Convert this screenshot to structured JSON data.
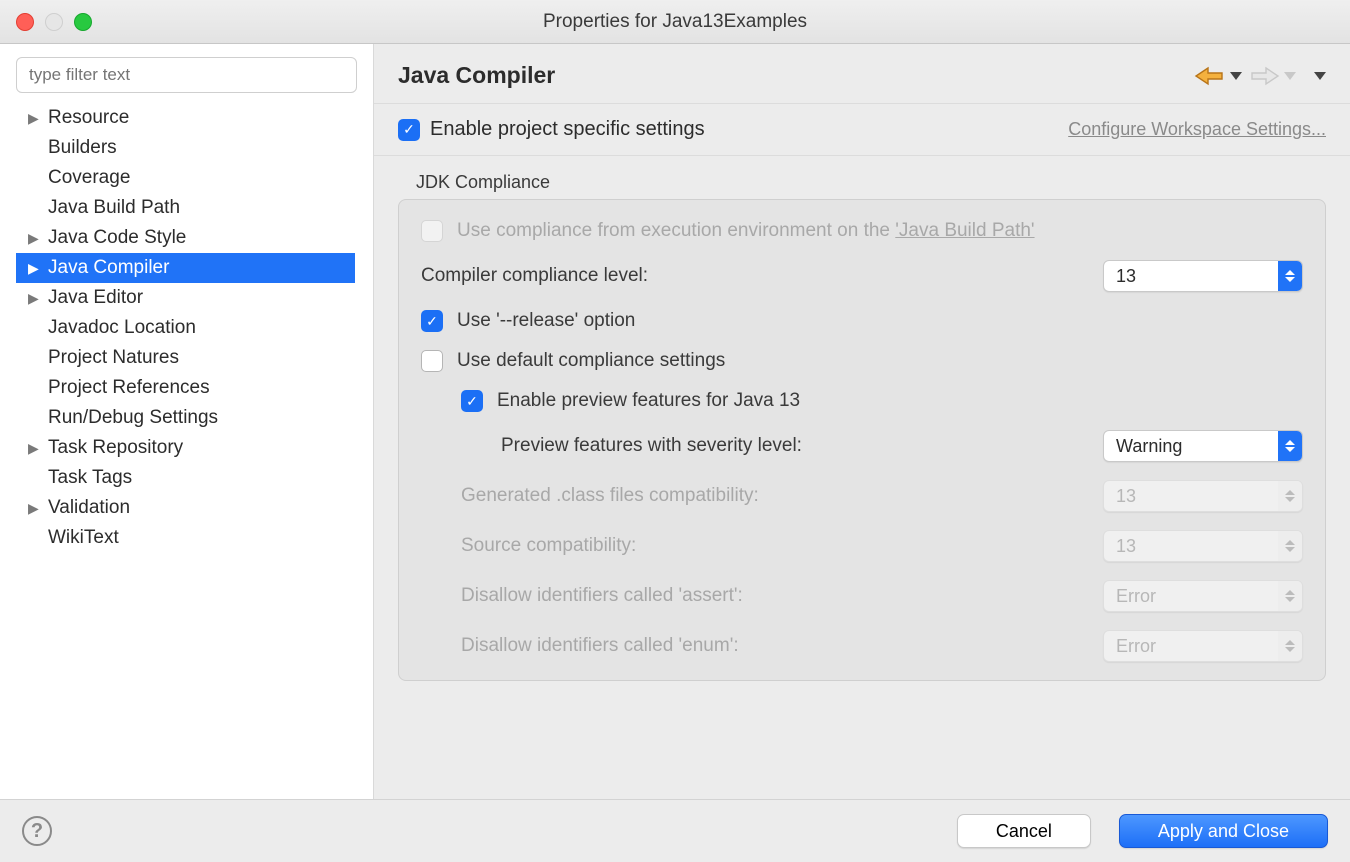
{
  "window": {
    "title": "Properties for Java13Examples"
  },
  "sidebar": {
    "filter_placeholder": "type filter text",
    "items": [
      {
        "label": "Resource",
        "hasChildren": true
      },
      {
        "label": "Builders",
        "hasChildren": false
      },
      {
        "label": "Coverage",
        "hasChildren": false
      },
      {
        "label": "Java Build Path",
        "hasChildren": false
      },
      {
        "label": "Java Code Style",
        "hasChildren": true
      },
      {
        "label": "Java Compiler",
        "hasChildren": true,
        "selected": true
      },
      {
        "label": "Java Editor",
        "hasChildren": true
      },
      {
        "label": "Javadoc Location",
        "hasChildren": false
      },
      {
        "label": "Project Natures",
        "hasChildren": false
      },
      {
        "label": "Project References",
        "hasChildren": false
      },
      {
        "label": "Run/Debug Settings",
        "hasChildren": false
      },
      {
        "label": "Task Repository",
        "hasChildren": true
      },
      {
        "label": "Task Tags",
        "hasChildren": false
      },
      {
        "label": "Validation",
        "hasChildren": true
      },
      {
        "label": "WikiText",
        "hasChildren": false
      }
    ]
  },
  "main": {
    "title": "Java Compiler",
    "enable_specific": {
      "label": "Enable project specific settings",
      "checked": true
    },
    "configure_link": "Configure Workspace Settings...",
    "group_title": "JDK Compliance",
    "use_exec_env_prefix": "Use compliance from execution environment on the ",
    "use_exec_env_link": "'Java Build Path'",
    "compliance_level": {
      "label": "Compiler compliance level:",
      "value": "13"
    },
    "use_release": {
      "label": "Use '--release' option",
      "checked": true
    },
    "use_default": {
      "label": "Use default compliance settings",
      "checked": false
    },
    "enable_preview": {
      "label": "Enable preview features for Java 13",
      "checked": true
    },
    "preview_severity": {
      "label": "Preview features with severity level:",
      "value": "Warning"
    },
    "class_compat": {
      "label": "Generated .class files compatibility:",
      "value": "13"
    },
    "source_compat": {
      "label": "Source compatibility:",
      "value": "13"
    },
    "disallow_assert": {
      "label": "Disallow identifiers called 'assert':",
      "value": "Error"
    },
    "disallow_enum": {
      "label": "Disallow identifiers called 'enum':",
      "value": "Error"
    }
  },
  "footer": {
    "cancel": "Cancel",
    "apply_close": "Apply and Close"
  }
}
